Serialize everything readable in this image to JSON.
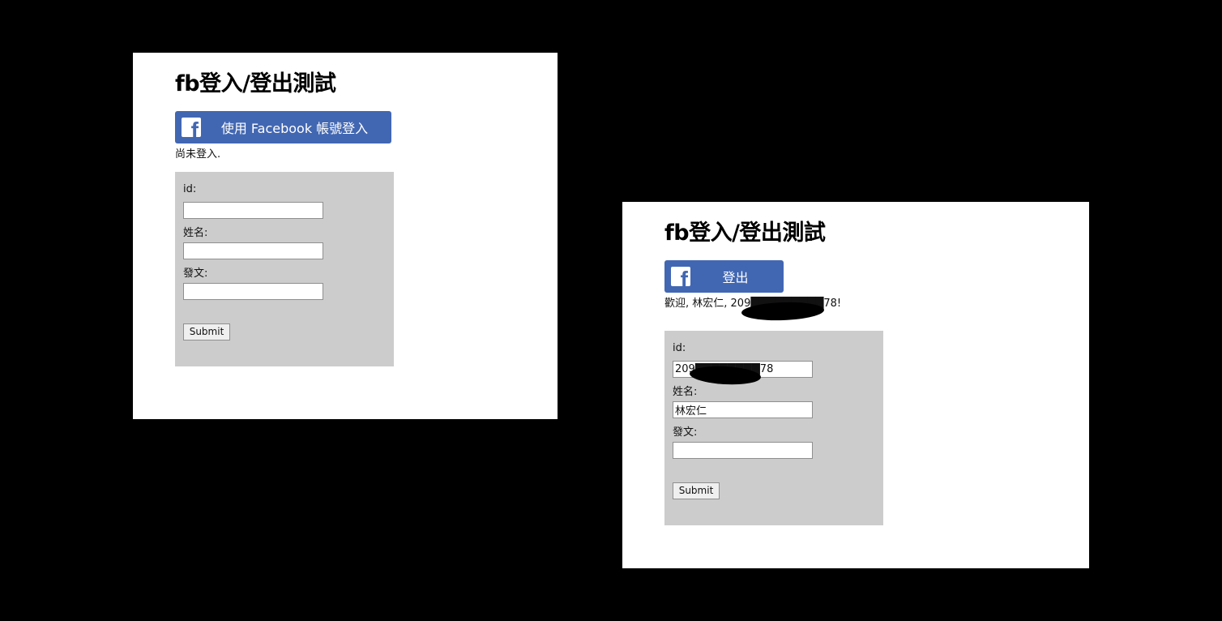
{
  "left": {
    "title": "fb登入/登出測試",
    "fb_button_label": "使用 Facebook 帳號登入",
    "status_text": "尚未登入.",
    "form": {
      "id_label": "id:",
      "id_value": "",
      "name_label": "姓名:",
      "name_value": "",
      "post_label": "發文:",
      "post_value": "",
      "submit_label": "Submit"
    }
  },
  "right": {
    "title": "fb登入/登出測試",
    "fb_button_label": "登出",
    "status_text": "歡迎, 林宏仁, 209█████████78!",
    "form": {
      "id_label": "id:",
      "id_value": "209████████78",
      "name_label": "姓名:",
      "name_value": "林宏仁",
      "post_label": "發文:",
      "post_value": "",
      "submit_label": "Submit"
    }
  },
  "icons": {
    "facebook": "facebook-f-icon"
  },
  "colors": {
    "facebook_blue": "#4267b2",
    "form_background": "#cccccc",
    "page_background": "#000000"
  }
}
